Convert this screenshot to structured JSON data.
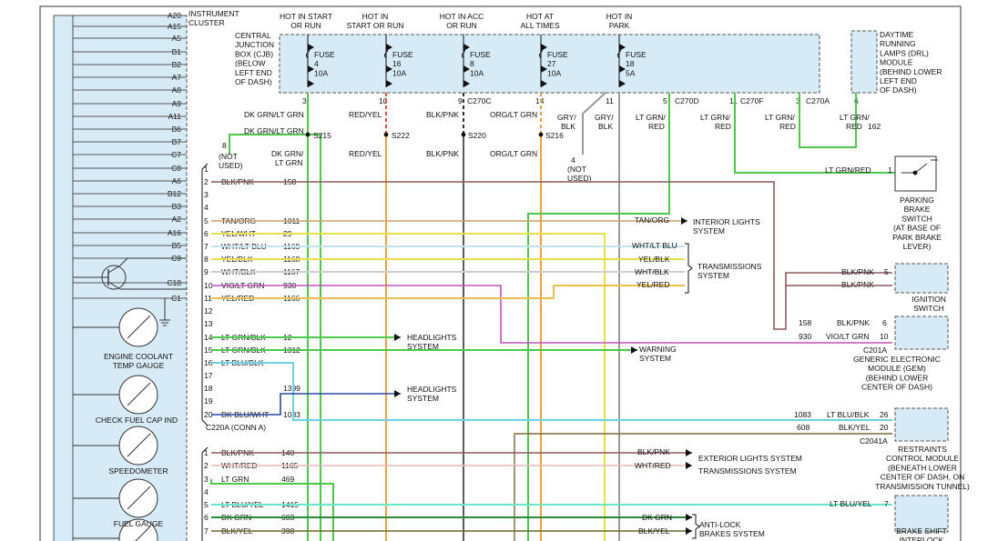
{
  "cluster": {
    "pins": [
      "A20",
      "A15",
      "A5",
      "B1",
      "B2",
      "A7",
      "A8",
      "A9",
      "A11",
      "B6",
      "B7",
      "C7",
      "C8",
      "A6",
      "B12",
      "B3",
      "A2",
      "A16",
      "B5",
      "C9",
      "C18",
      "C1"
    ],
    "title": [
      "INSTRUMENT",
      "CLUSTER"
    ],
    "gauges": [
      "ENGINE COOLANT",
      "TEMP GAUGE",
      "CHECK FUEL CAP IND",
      "SPEEDOMETER",
      "FUEL GAUGE"
    ]
  },
  "cjb": {
    "label": [
      "CENTRAL",
      "JUNCTION",
      "BOX (CJB)",
      "(BELOW",
      "LEFT END",
      "OF DASH)"
    ],
    "hot": [
      [
        "HOT IN START",
        "OR RUN"
      ],
      [
        "HOT IN",
        "START OR RUN"
      ],
      [
        "HOT IN ACC",
        "OR RUN"
      ],
      [
        "HOT AT",
        "ALL TIMES"
      ],
      [
        "HOT IN",
        "PARK"
      ]
    ],
    "fuses": [
      [
        "FUSE",
        "4",
        "10A"
      ],
      [
        "FUSE",
        "16",
        "10A"
      ],
      [
        "FUSE",
        "8",
        "10A"
      ],
      [
        "FUSE",
        "27",
        "10A"
      ],
      [
        "FUSE",
        "18",
        "5A"
      ]
    ],
    "pins": [
      "3",
      "10",
      "9",
      "14",
      "11",
      "5",
      "11",
      "3"
    ],
    "connectors": [
      "C270C",
      "C270D",
      "C270F",
      "C270A"
    ]
  },
  "drl": {
    "label": [
      "DAYTIME",
      "RUNNING",
      "LAMPS (DRL)",
      "MODULE",
      "(BEHIND LOWER",
      "LEFT END",
      "OF DASH)"
    ],
    "pin": "6",
    "circuit": "162"
  },
  "wires_top": [
    "DK GRN/LT GRN",
    "RED/YEL",
    "BLK/PNK",
    "ORG/LT GRN",
    "GRY/",
    "BLK",
    "GRY/",
    "BLK",
    "LT GRN/",
    "RED",
    "LT GRN/",
    "RED",
    "LT GRN/",
    "RED",
    "LT GRN/",
    "RED"
  ],
  "splices": [
    "S215",
    "S222",
    "S220",
    "S216"
  ],
  "mid_labels": [
    "DK GRN/LT GRN",
    "DK GRN/",
    "LT GRN",
    "RED/YEL",
    "BLK/PNK",
    "ORG/LT GRN"
  ],
  "notused": {
    "a_pin": "8",
    "a_text": [
      "(NOT",
      "USED)"
    ],
    "b_pin": "4",
    "b_text": [
      "(NOT",
      "USED)"
    ]
  },
  "conn_a": {
    "rows": [
      {
        "n": "1",
        "color": "",
        "circ": ""
      },
      {
        "n": "2",
        "color": "BLK/PNK",
        "circ": "158"
      },
      {
        "n": "3",
        "color": "",
        "circ": ""
      },
      {
        "n": "4",
        "color": "",
        "circ": ""
      },
      {
        "n": "5",
        "color": "TAN/ORG",
        "circ": "1011"
      },
      {
        "n": "6",
        "color": "YEL/WHT",
        "circ": "29"
      },
      {
        "n": "7",
        "color": "WHT/LT BLU",
        "circ": "1169"
      },
      {
        "n": "8",
        "color": "YEL/BLK",
        "circ": "1168"
      },
      {
        "n": "9",
        "color": "WHT/BLK",
        "circ": "1167"
      },
      {
        "n": "10",
        "color": "VIO/LT GRN",
        "circ": "930"
      },
      {
        "n": "11",
        "color": "YEL/RED",
        "circ": "1166"
      },
      {
        "n": "12",
        "color": "",
        "circ": ""
      },
      {
        "n": "13",
        "color": "",
        "circ": ""
      },
      {
        "n": "14",
        "color": "LT GRN/BLK",
        "circ": "12"
      },
      {
        "n": "15",
        "color": "LT GRN/BLK",
        "circ": "1312"
      },
      {
        "n": "16",
        "color": "LT BLU/BLK",
        "circ": ""
      },
      {
        "n": "17",
        "color": "",
        "circ": ""
      },
      {
        "n": "18",
        "color": "",
        "circ": "1399"
      },
      {
        "n": "19",
        "color": "",
        "circ": ""
      },
      {
        "n": "20",
        "color": "DK BLU/WHT",
        "circ": "1083"
      }
    ],
    "label": "C220A     (CONN A)"
  },
  "conn_b": {
    "rows": [
      {
        "n": "1",
        "color": "BLK/PNK",
        "circ": "140"
      },
      {
        "n": "2",
        "color": "WHT/RED",
        "circ": "1165"
      },
      {
        "n": "3",
        "color": "LT GRN",
        "circ": "469"
      },
      {
        "n": "4",
        "color": "",
        "circ": ""
      },
      {
        "n": "5",
        "color": "LT BLU/YEL",
        "circ": "1415"
      },
      {
        "n": "6",
        "color": "DK GRN",
        "circ": "603"
      },
      {
        "n": "7",
        "color": "BLK/YEL",
        "circ": "398"
      }
    ]
  },
  "right_labels": {
    "tan_org": "TAN/ORG",
    "interior": [
      "INTERIOR LIGHTS",
      "SYSTEM"
    ],
    "trans_colors": [
      "WHT/LT BLU",
      "YEL/BLK",
      "WHT/BLK",
      "YEL/RED"
    ],
    "trans": [
      "TRANSMISSIONS",
      "SYSTEM"
    ],
    "headlights": [
      "HEADLIGHTS",
      "SYSTEM"
    ],
    "warning": [
      "WARNING",
      "SYSTEM"
    ],
    "headlights2": [
      "HEADLIGHTS",
      "SYSTEM"
    ],
    "ext_colors": [
      "BLK/PNK",
      "WHT/RED"
    ],
    "ext": [
      "EXTERIOR LIGHTS SYSTEM",
      "TRANSMISSIONS SYSTEM"
    ],
    "abs_colors": [
      "DK GRN",
      "BLK/YEL"
    ],
    "abs": [
      "ANTI-LOCK",
      "BRAKES SYSTEM"
    ]
  },
  "park_brake": {
    "wire": "LT GRN/RED",
    "pin": "1",
    "label": [
      "PARKING",
      "BRAKE",
      "SWITCH",
      "(AT BASE OF",
      "PARK BRAKE",
      "LEVER)"
    ]
  },
  "ignition": {
    "wire1": "BLK/PNK",
    "wire2": "BLK/PNK",
    "pin": "5",
    "label": [
      "IGNITION",
      "SWITCH"
    ]
  },
  "gem": {
    "w1_circ": "158",
    "w1_color": "BLK/PNK",
    "w1_pin": "6",
    "w2_circ": "930",
    "w2_color": "VIO/LT GRN",
    "w2_pin": "10",
    "conn": "C201A",
    "label": [
      "GENERIC ELECTRONIC",
      "MODULE (GEM)",
      "(BEHIND LOWER",
      "CENTER OF DASH)"
    ]
  },
  "rcm": {
    "w1_circ": "1083",
    "w1_color": "LT BLU/BLK",
    "w1_pin": "26",
    "w2_circ": "608",
    "w2_color": "BLK/YEL",
    "w2_pin": "20",
    "conn": "C2041A",
    "label": [
      "RESTRAINTS",
      "CONTROL MODULE",
      "(BENEATH LOWER",
      "CENTER OF DASH, ON",
      "TRANSMISSION TUNNEL)"
    ]
  },
  "brake_shift": {
    "wire": "LT BLU/YEL",
    "pin": "7",
    "label": [
      "BRAKE SHIFT",
      "INTERLOCK"
    ]
  }
}
